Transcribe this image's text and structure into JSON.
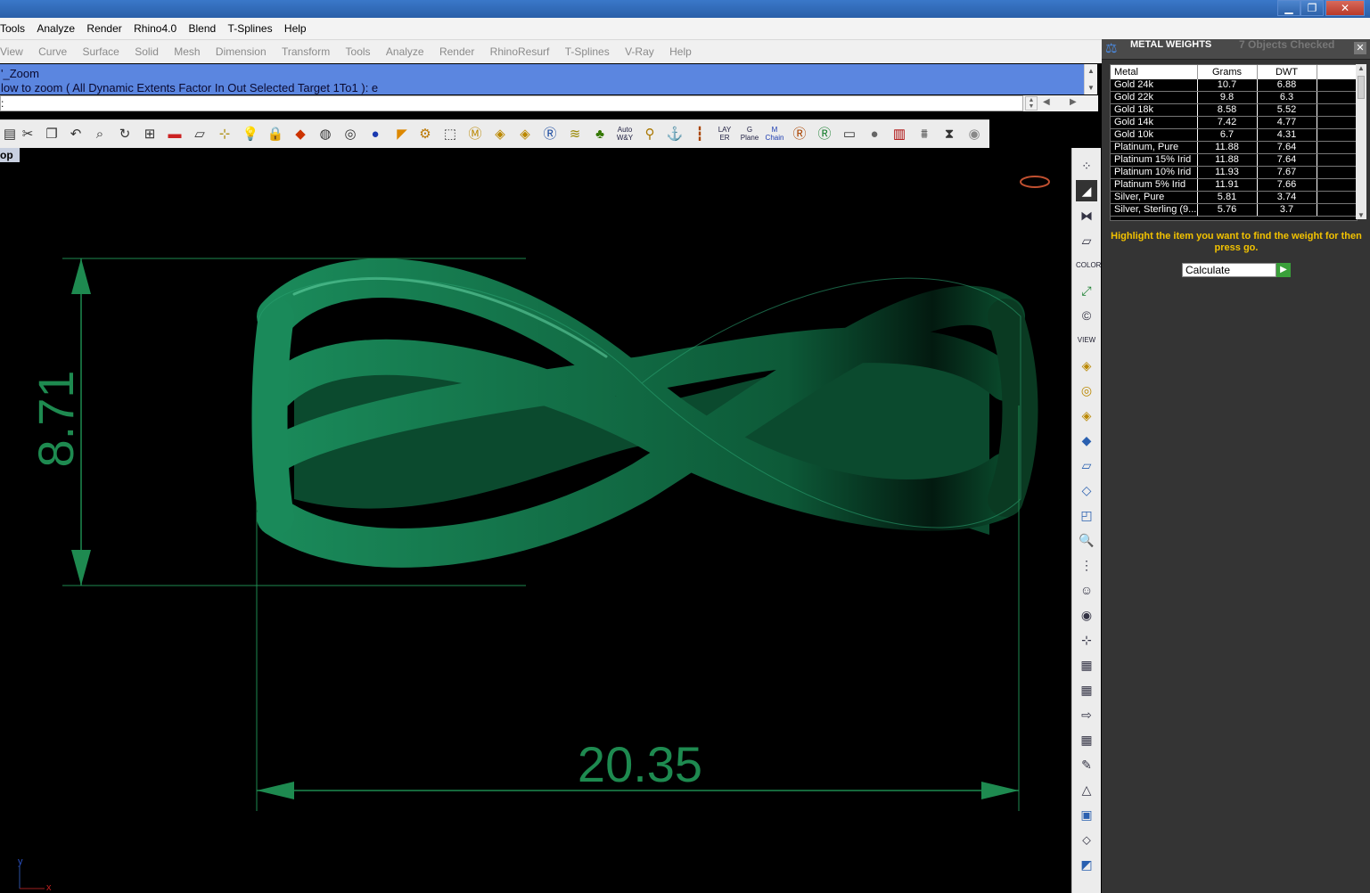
{
  "window": {
    "controls": [
      "▁",
      "❐",
      "✕"
    ]
  },
  "menubar": [
    "Tools",
    "Analyze",
    "Render",
    "Rhino4.0",
    "Blend",
    "T-Splines",
    "Help"
  ],
  "toolmenu": [
    "View",
    "Curve",
    "Surface",
    "Solid",
    "Mesh",
    "Dimension",
    "Transform",
    "Tools",
    "Analyze",
    "Render",
    "RhinoResurf",
    "T-Splines",
    "V-Ray",
    "Help"
  ],
  "command": {
    "history_line1": "'_Zoom",
    "history_line2": "low to zoom ( All  Dynamic  Extents  Factor  In  Out  Selected  Target  1To1 ): e",
    "prompt": ":"
  },
  "toolbar": {
    "auto_label": "Auto W&Y",
    "layer_label": "LAY ER",
    "plane_label": "G Plane",
    "chain_label": "M Chain"
  },
  "viewport": {
    "name": "op",
    "dim_height": "8.71",
    "dim_width": "20.35",
    "axis_y": "y",
    "axis_x": "x",
    "model_color": "#0e5e3a",
    "dim_color": "#1e8a50"
  },
  "vtoolbar": {
    "color_label": "COLOR",
    "view_label": "VIEW"
  },
  "panel": {
    "title": "METAL WEIGHTS",
    "status": "7 Objects Checked",
    "columns": [
      "Metal",
      "Grams",
      "DWT"
    ],
    "rows": [
      [
        "Gold 24k",
        "10.7",
        "6.88"
      ],
      [
        "Gold 22k",
        "9.8",
        "6.3"
      ],
      [
        "Gold 18k",
        "8.58",
        "5.52"
      ],
      [
        "Gold 14k",
        "7.42",
        "4.77"
      ],
      [
        "Gold 10k",
        "6.7",
        "4.31"
      ],
      [
        "Platinum, Pure",
        "11.88",
        "7.64"
      ],
      [
        "Platinum 15% Irid",
        "11.88",
        "7.64"
      ],
      [
        "Platinum 10% Irid",
        "11.93",
        "7.67"
      ],
      [
        "Platinum 5% Irid",
        "11.91",
        "7.66"
      ],
      [
        "Silver, Pure",
        "5.81",
        "3.74"
      ],
      [
        "Silver, Sterling (9...",
        "5.76",
        "3.7"
      ]
    ],
    "hint": "Highlight the item you want to find the weight for then press go.",
    "calc_option": "Calculate",
    "go_icon": "▶"
  }
}
